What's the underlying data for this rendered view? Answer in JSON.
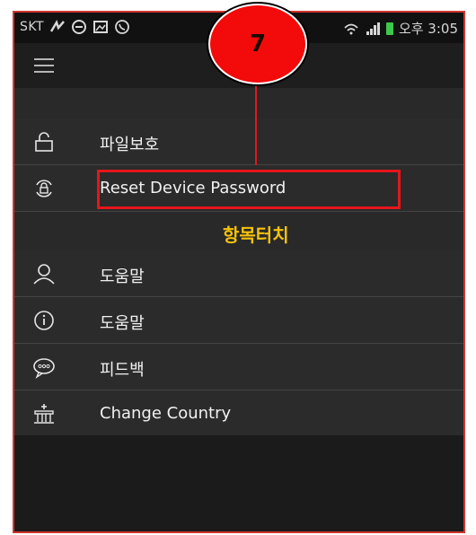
{
  "status_bar": {
    "carrier": "SKT",
    "time": "오후 3:05"
  },
  "menu": {
    "items": [
      {
        "label": "파일보호",
        "icon": "lock-icon"
      },
      {
        "label": "Reset Device Password",
        "icon": "reset-lock-icon"
      },
      {
        "label": "도움말",
        "icon": "person-icon"
      },
      {
        "label": "도움말",
        "icon": "info-icon"
      },
      {
        "label": "피드백",
        "icon": "chat-icon"
      },
      {
        "label": "Change Country",
        "icon": "building-icon"
      }
    ]
  },
  "annotation": {
    "step_number": "7",
    "instruction": "항목터치"
  },
  "colors": {
    "highlight": "#e5161b",
    "instruction_text": "#f5c30b",
    "battery": "#3ec84b",
    "menu_bg": "#2b2b2b"
  }
}
